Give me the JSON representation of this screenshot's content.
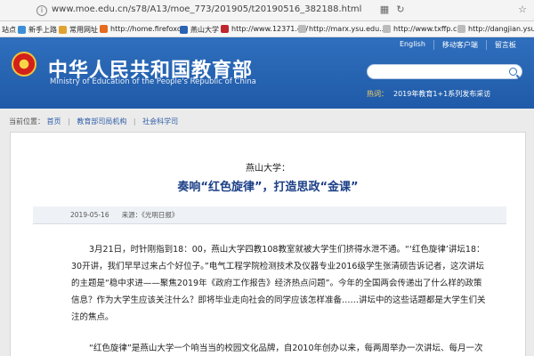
{
  "browser": {
    "url": "www.moe.edu.cn/s78/A13/moe_773/201905/t20190516_382188.html",
    "bookmarks": [
      "站点",
      "新手上路",
      "常用网址",
      "http://home.firefoxc...",
      "燕山大学",
      "http://www.12371.cn/",
      "http://marx.ysu.edu...",
      "http://www.txffp.cn/",
      "http://dangjian.ysu..."
    ]
  },
  "header": {
    "title_cn": "中华人民共和国教育部",
    "title_en": "Ministry of Education of the People's Republic of China",
    "top_links": [
      "English",
      "移动客户端",
      "留言板"
    ],
    "hot_label": "热词：",
    "hot_text": "2019年教育1+1系列发布采访"
  },
  "breadcrumb": {
    "label": "当前位置：",
    "items": [
      "首页",
      "教育部司局机构",
      "社会科学司"
    ]
  },
  "article": {
    "kicker": "燕山大学：",
    "title": "奏响“红色旋律”，打造思政“金课”",
    "date": "2019-05-16",
    "source": "来源：《光明日报》",
    "paragraphs": [
      "3月21日，时针刚指到18：00，燕山大学四教108教室就被大学生们挤得水泄不通。“‘红色旋律’讲坛18：30开讲，我们早早过来占个好位子。”电气工程学院检测技术及仪器专业2016级学生张清硕告诉记者，这次讲坛的主题是“稳中求进——聚焦2019年《政府工作报告》经济热点问题”。今年的全国两会传递出了什么样的政策信息？作为大学生应该关注什么？即将毕业走向社会的同学应该怎样准备……讲坛中的这些话题都是大学生们关注的焦点。",
      "“红色旋律”是燕山大学一个响当当的校园文化品牌，自2010年创办以来，每两周举办一次讲坛、每月一次"
    ]
  },
  "colors": {
    "header_blue": "#2f6fbd",
    "title_blue": "#1b3f87",
    "hot_yellow": "#ffd45a"
  }
}
